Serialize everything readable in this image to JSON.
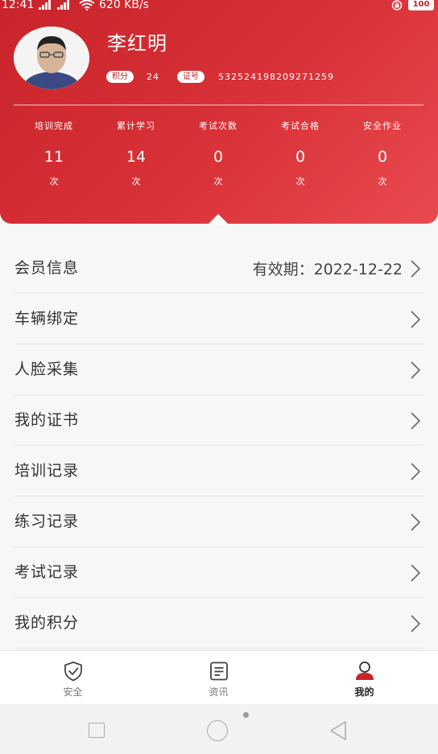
{
  "status_bar": {
    "time": "12:41",
    "speed": "620 KB/s",
    "battery": "100"
  },
  "profile": {
    "name": "李红明",
    "points_label": "积分",
    "points_value": "24",
    "cert_label": "证号",
    "cert_value": "532524198209271259"
  },
  "stats": [
    {
      "label": "培训完成",
      "value": "11",
      "unit": "次"
    },
    {
      "label": "累计学习",
      "value": "14",
      "unit": "次"
    },
    {
      "label": "考试次数",
      "value": "0",
      "unit": "次"
    },
    {
      "label": "考试合格",
      "value": "0",
      "unit": "次"
    },
    {
      "label": "安全作业",
      "value": "0",
      "unit": "次"
    }
  ],
  "menu": [
    {
      "label": "会员信息",
      "value": "有效期：2022-12-22"
    },
    {
      "label": "车辆绑定"
    },
    {
      "label": "人脸采集"
    },
    {
      "label": "我的证书"
    },
    {
      "label": "培训记录"
    },
    {
      "label": "练习记录"
    },
    {
      "label": "考试记录"
    },
    {
      "label": "我的积分"
    }
  ],
  "tabs": [
    {
      "label": "安全",
      "icon": "shield-check-icon",
      "active": false
    },
    {
      "label": "资讯",
      "icon": "news-icon",
      "active": false
    },
    {
      "label": "我的",
      "icon": "user-icon",
      "active": true
    }
  ],
  "colors": {
    "brand_red": "#d32f35",
    "active_tab_icon": "#c9242b"
  }
}
